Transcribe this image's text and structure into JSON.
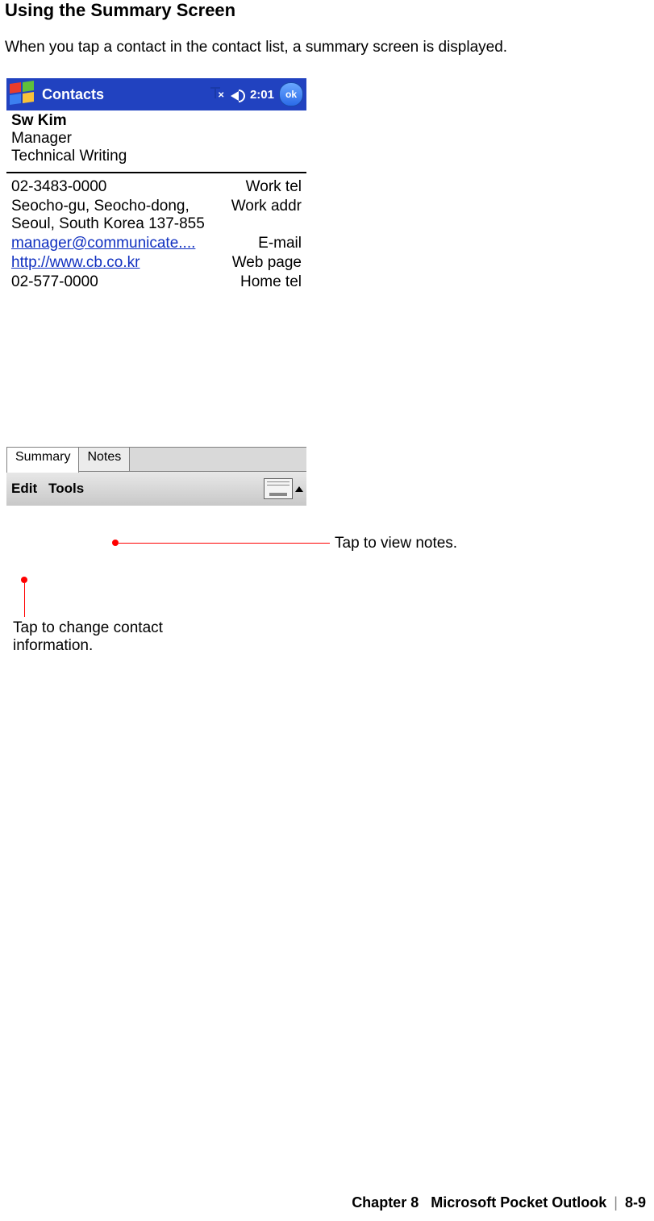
{
  "heading": "Using the Summary Screen",
  "intro": "When you tap a contact in the contact list, a summary screen is displayed.",
  "titlebar": {
    "app": "Contacts",
    "time": "2:01",
    "ok": "ok"
  },
  "contact": {
    "name": "Sw Kim",
    "title": "Manager",
    "dept": "Technical Writing"
  },
  "details": {
    "work_tel": {
      "value": "02-3483-0000",
      "label": "Work tel"
    },
    "work_addr": {
      "value": "Seocho-gu, Seocho-dong, Seoul, South Korea 137-855",
      "label": "Work addr"
    },
    "email": {
      "value": "manager@communicate....",
      "label": "E-mail"
    },
    "web": {
      "value": "http://www.cb.co.kr",
      "label": "Web page"
    },
    "home_tel": {
      "value": "02-577-0000",
      "label": "Home tel"
    }
  },
  "tabs": {
    "summary": "Summary",
    "notes": "Notes"
  },
  "menu": {
    "edit": "Edit",
    "tools": "Tools"
  },
  "callouts": {
    "notes": "Tap to view notes.",
    "edit": "Tap to change contact information."
  },
  "footer": {
    "chapter": "Chapter 8",
    "title": "Microsoft Pocket Outlook",
    "page": "8-9"
  }
}
